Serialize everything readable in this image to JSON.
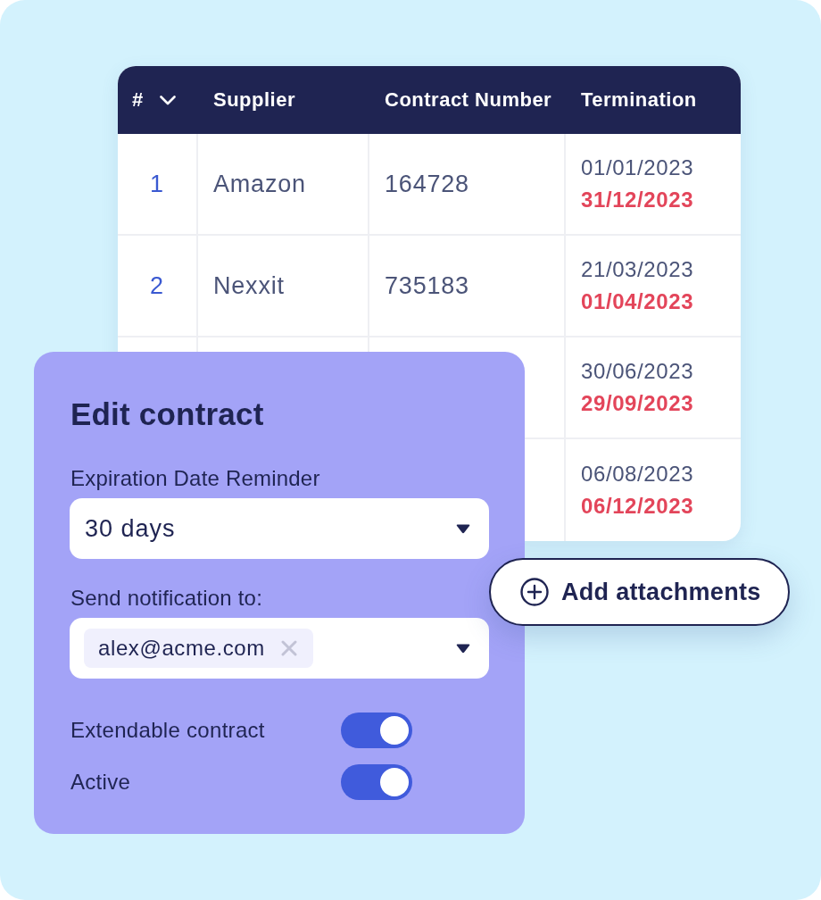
{
  "table": {
    "columns": [
      "#",
      "Supplier",
      "Contract Number",
      "Termination"
    ],
    "rows": [
      {
        "number": "1",
        "supplier": "Amazon",
        "contract_number": "164728",
        "termination": {
          "start": "01/01/2023",
          "end": "31/12/2023"
        }
      },
      {
        "number": "2",
        "supplier": "Nexxit",
        "contract_number": "735183",
        "termination": {
          "start": "21/03/2023",
          "end": "01/04/2023"
        }
      },
      {
        "termination": {
          "start": "30/06/2023",
          "end": "29/09/2023"
        }
      },
      {
        "termination": {
          "start": "06/08/2023",
          "end": "06/12/2023"
        }
      }
    ]
  },
  "edit_panel": {
    "title": "Edit contract",
    "fields": [
      {
        "kind": "select",
        "label": "Expiration Date Reminder",
        "value": "30 days"
      },
      {
        "kind": "tags",
        "label": "Send notification to:",
        "tags": [
          "alex@acme.com"
        ]
      }
    ],
    "toggles": [
      {
        "label": "Extendable contract",
        "on": true
      },
      {
        "label": "Active",
        "on": true
      }
    ]
  },
  "add_button": {
    "label": "Add attachments"
  }
}
